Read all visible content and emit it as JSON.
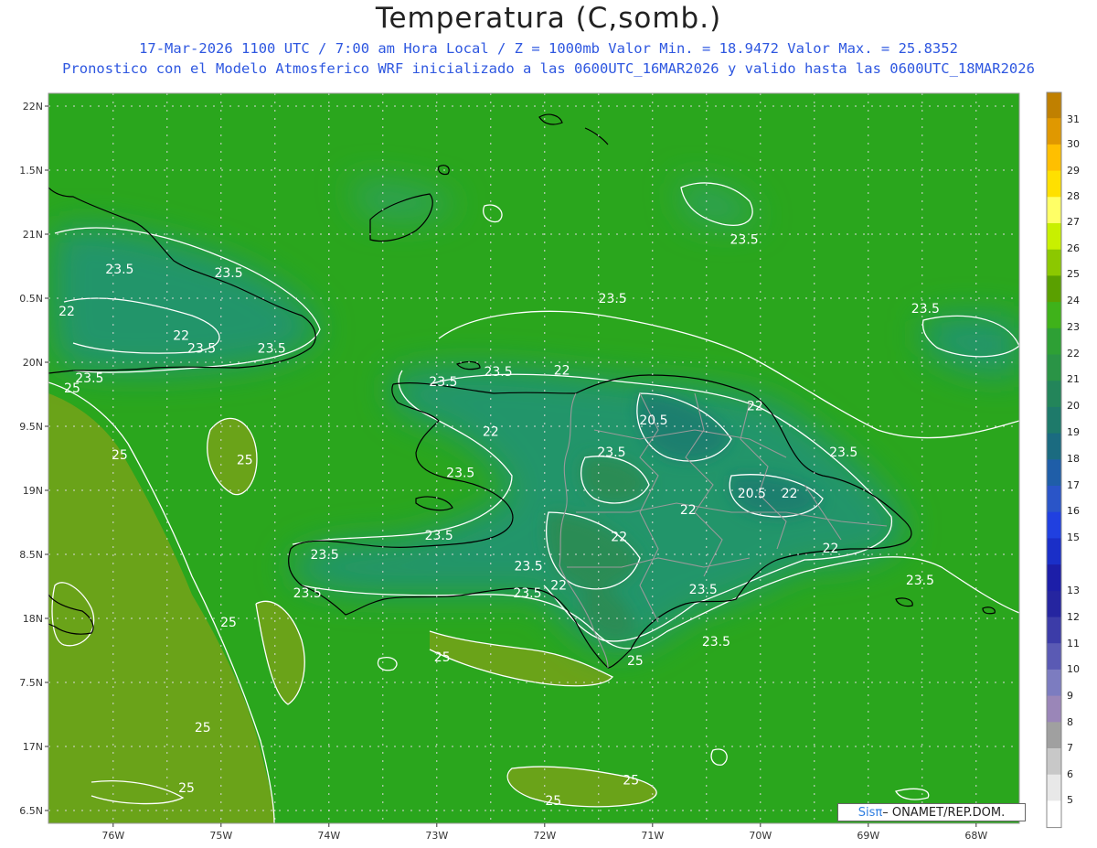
{
  "header": {
    "title": "Temperatura (C,somb.)",
    "line1": "17-Mar-2026  1100 UTC / 7:00 am Hora Local / Z = 1000mb   Valor Min. = 18.9472  Valor Max. = 25.8352",
    "line2": "Pronostico con el Modelo Atmosferico WRF inicializado a las 0600UTC_16MAR2026 y valido hasta las  0600UTC_18MAR2026"
  },
  "axes": {
    "lat_labels": [
      "22N",
      "1.5N",
      "21N",
      "0.5N",
      "20N",
      "9.5N",
      "19N",
      "8.5N",
      "18N",
      "7.5N",
      "17N",
      "6.5N"
    ],
    "lon_labels": [
      "76W",
      "75W",
      "74W",
      "73W",
      "72W",
      "71W",
      "70W",
      "69W",
      "68W"
    ]
  },
  "colorbar": {
    "labels": [
      "31",
      "30",
      "29",
      "28",
      "27",
      "26",
      "25",
      "24",
      "23",
      "22",
      "21",
      "20",
      "19",
      "18",
      "17",
      "16",
      "15",
      "13",
      "12",
      "11",
      "10",
      "9",
      "8",
      "7",
      "6",
      "5"
    ],
    "colors": [
      "#c08000",
      "#e09800",
      "#ffbf00",
      "#ffe000",
      "#ffff66",
      "#c8f000",
      "#8cc800",
      "#5aa000",
      "#3fb21a",
      "#2ea035",
      "#2a9446",
      "#23855a",
      "#1e7a6a",
      "#1b6b80",
      "#1f5ea8",
      "#2a55c8",
      "#2040e0",
      "#1a2fc8",
      "#1c1ea8",
      "#2525a0",
      "#3c3ca8",
      "#5a5ab4",
      "#7c7cc0",
      "#9a86b8",
      "#a0a0a0",
      "#c8c8c8",
      "#e8e8e8",
      "#ffffff"
    ]
  },
  "contour_labels": [
    {
      "text": "23.5",
      "lon": -75.94,
      "lat": 20.73
    },
    {
      "text": "23.5",
      "lon": -74.93,
      "lat": 20.7
    },
    {
      "text": "22",
      "lon": -76.43,
      "lat": 20.4
    },
    {
      "text": "22",
      "lon": -75.37,
      "lat": 20.21
    },
    {
      "text": "23.5",
      "lon": -75.18,
      "lat": 20.11
    },
    {
      "text": "23.5",
      "lon": -74.53,
      "lat": 20.11
    },
    {
      "text": "23.5",
      "lon": -76.22,
      "lat": 19.88
    },
    {
      "text": "25",
      "lon": -76.38,
      "lat": 19.8
    },
    {
      "text": "23.5",
      "lon": -71.37,
      "lat": 20.5
    },
    {
      "text": "23.5",
      "lon": -70.15,
      "lat": 20.96
    },
    {
      "text": "23.5",
      "lon": -68.47,
      "lat": 20.42
    },
    {
      "text": "23.5",
      "lon": -72.43,
      "lat": 19.93
    },
    {
      "text": "22",
      "lon": -71.84,
      "lat": 19.94
    },
    {
      "text": "23.5",
      "lon": -72.94,
      "lat": 19.85
    },
    {
      "text": "20.5",
      "lon": -70.99,
      "lat": 19.55
    },
    {
      "text": "22",
      "lon": -70.05,
      "lat": 19.66
    },
    {
      "text": "22",
      "lon": -72.5,
      "lat": 19.46
    },
    {
      "text": "23.5",
      "lon": -71.38,
      "lat": 19.3
    },
    {
      "text": "23.5",
      "lon": -69.23,
      "lat": 19.3
    },
    {
      "text": "25",
      "lon": -75.94,
      "lat": 19.28
    },
    {
      "text": "25",
      "lon": -74.78,
      "lat": 19.24
    },
    {
      "text": "23.5",
      "lon": -72.78,
      "lat": 19.14
    },
    {
      "text": "20.5",
      "lon": -70.08,
      "lat": 18.98
    },
    {
      "text": "22",
      "lon": -69.73,
      "lat": 18.98
    },
    {
      "text": "22",
      "lon": -70.67,
      "lat": 18.85
    },
    {
      "text": "23.5",
      "lon": -72.98,
      "lat": 18.65
    },
    {
      "text": "22",
      "lon": -71.31,
      "lat": 18.64
    },
    {
      "text": "22",
      "lon": -69.35,
      "lat": 18.55
    },
    {
      "text": "23.5",
      "lon": -74.04,
      "lat": 18.5
    },
    {
      "text": "23.5",
      "lon": -72.15,
      "lat": 18.41
    },
    {
      "text": "23.5",
      "lon": -68.52,
      "lat": 18.3
    },
    {
      "text": "23.5",
      "lon": -74.2,
      "lat": 18.2
    },
    {
      "text": "22",
      "lon": -71.87,
      "lat": 18.26
    },
    {
      "text": "23.5",
      "lon": -70.53,
      "lat": 18.23
    },
    {
      "text": "23.5",
      "lon": -72.16,
      "lat": 18.2
    },
    {
      "text": "25",
      "lon": -74.93,
      "lat": 17.97
    },
    {
      "text": "23.5",
      "lon": -70.41,
      "lat": 17.82
    },
    {
      "text": "25",
      "lon": -72.95,
      "lat": 17.7
    },
    {
      "text": "25",
      "lon": -71.16,
      "lat": 17.67
    },
    {
      "text": "25",
      "lon": -75.17,
      "lat": 17.15
    },
    {
      "text": "25",
      "lon": -71.2,
      "lat": 16.74
    },
    {
      "text": "25",
      "lon": -75.32,
      "lat": 16.68
    },
    {
      "text": "25",
      "lon": -71.92,
      "lat": 16.58
    }
  ],
  "credit": {
    "logo": "Sisπ",
    "text": "– ONAMET/REP.DOM."
  }
}
